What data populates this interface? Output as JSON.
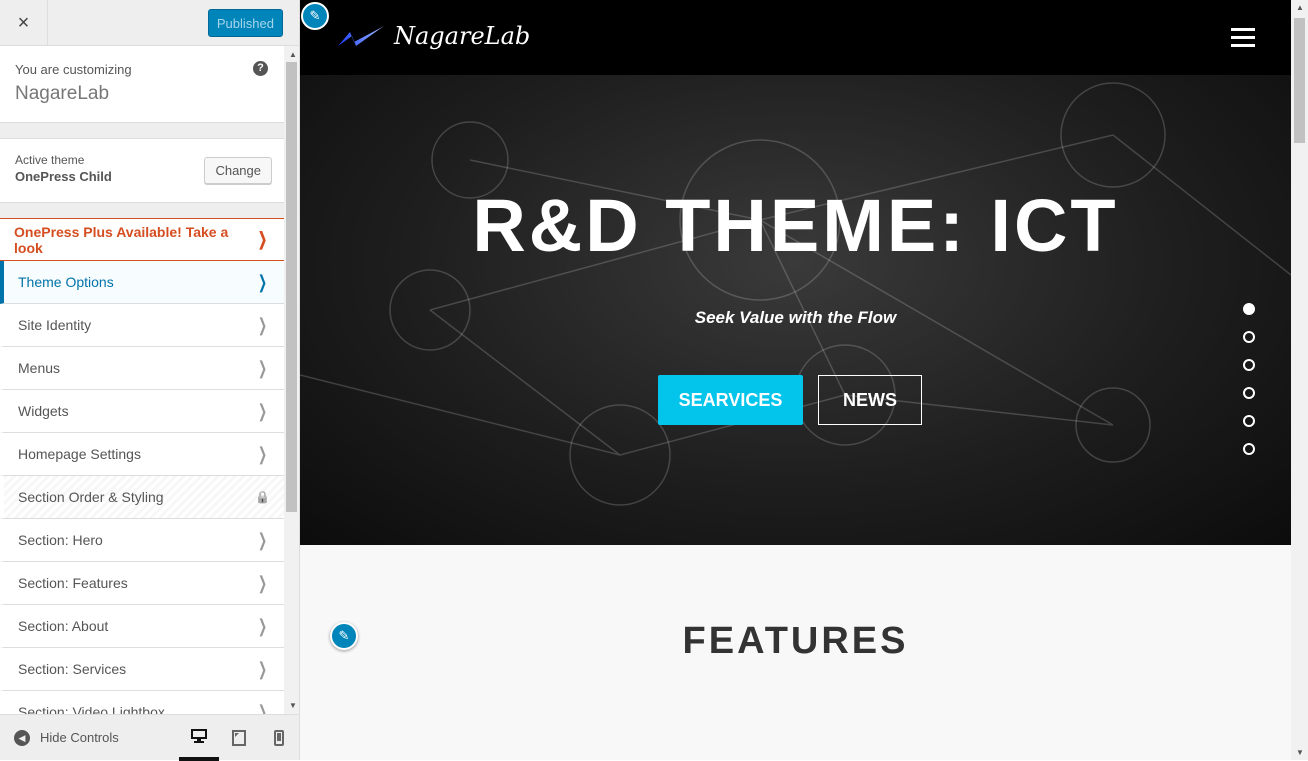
{
  "sidebar": {
    "close_label": "×",
    "publish_label": "Published",
    "customizing_label": "You are customizing",
    "site_name": "NagareLab",
    "help_label": "?",
    "active_theme_label": "Active theme",
    "active_theme_name": "OnePress Child",
    "change_label": "Change",
    "promo_label": "OnePress Plus Available! Take a look",
    "items": [
      {
        "label": "Theme Options",
        "state": "active"
      },
      {
        "label": "Site Identity"
      },
      {
        "label": "Menus"
      },
      {
        "label": "Widgets"
      },
      {
        "label": "Homepage Settings"
      },
      {
        "label": "Section Order & Styling",
        "state": "locked"
      },
      {
        "label": "Section: Hero"
      },
      {
        "label": "Section: Features"
      },
      {
        "label": "Section: About"
      },
      {
        "label": "Section: Services"
      },
      {
        "label": "Section: Video Lightbox"
      }
    ],
    "hide_controls_label": "Hide Controls",
    "devices": [
      "desktop",
      "tablet",
      "mobile"
    ],
    "active_device": "desktop"
  },
  "preview": {
    "logo_text": "NagareLab",
    "hero_title": "R&D THEME: ICT",
    "hero_subtitle": "Seek Value with the Flow",
    "primary_button": "SEARVICES",
    "secondary_button": "NEWS",
    "slide_count": 6,
    "active_slide": 1,
    "features_title": "FEATURES"
  },
  "colors": {
    "accent": "#0085ba",
    "promo": "#d54e21",
    "hero_button": "#03c4eb"
  }
}
